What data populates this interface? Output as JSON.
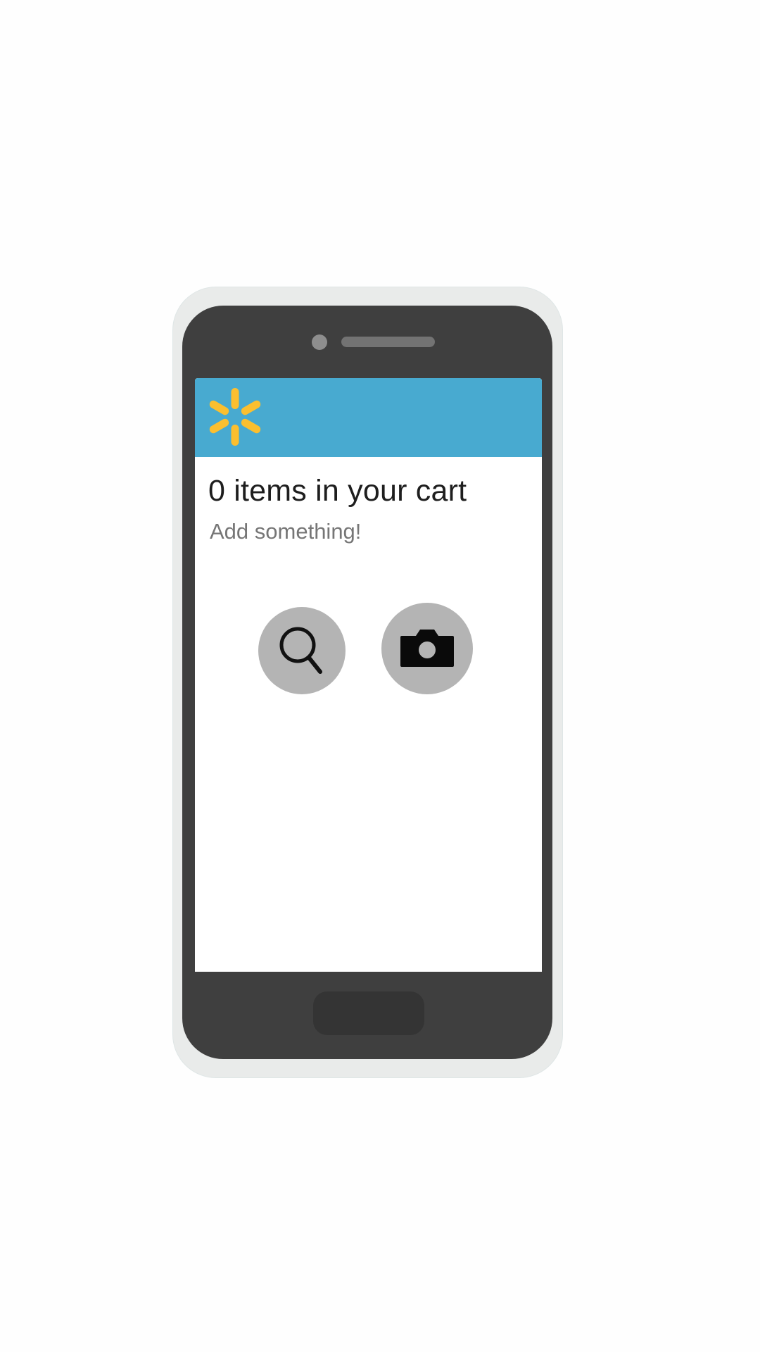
{
  "app": {
    "brand_logo": "walmart-spark-logo",
    "brand_color": "#48aad0",
    "logo_color": "#fbbf2f"
  },
  "cart": {
    "title": "0 items in your cart",
    "subtitle": "Add something!"
  },
  "actions": {
    "search_icon": "search-icon",
    "camera_icon": "camera-icon"
  },
  "device": {
    "home_button": "home-button"
  }
}
